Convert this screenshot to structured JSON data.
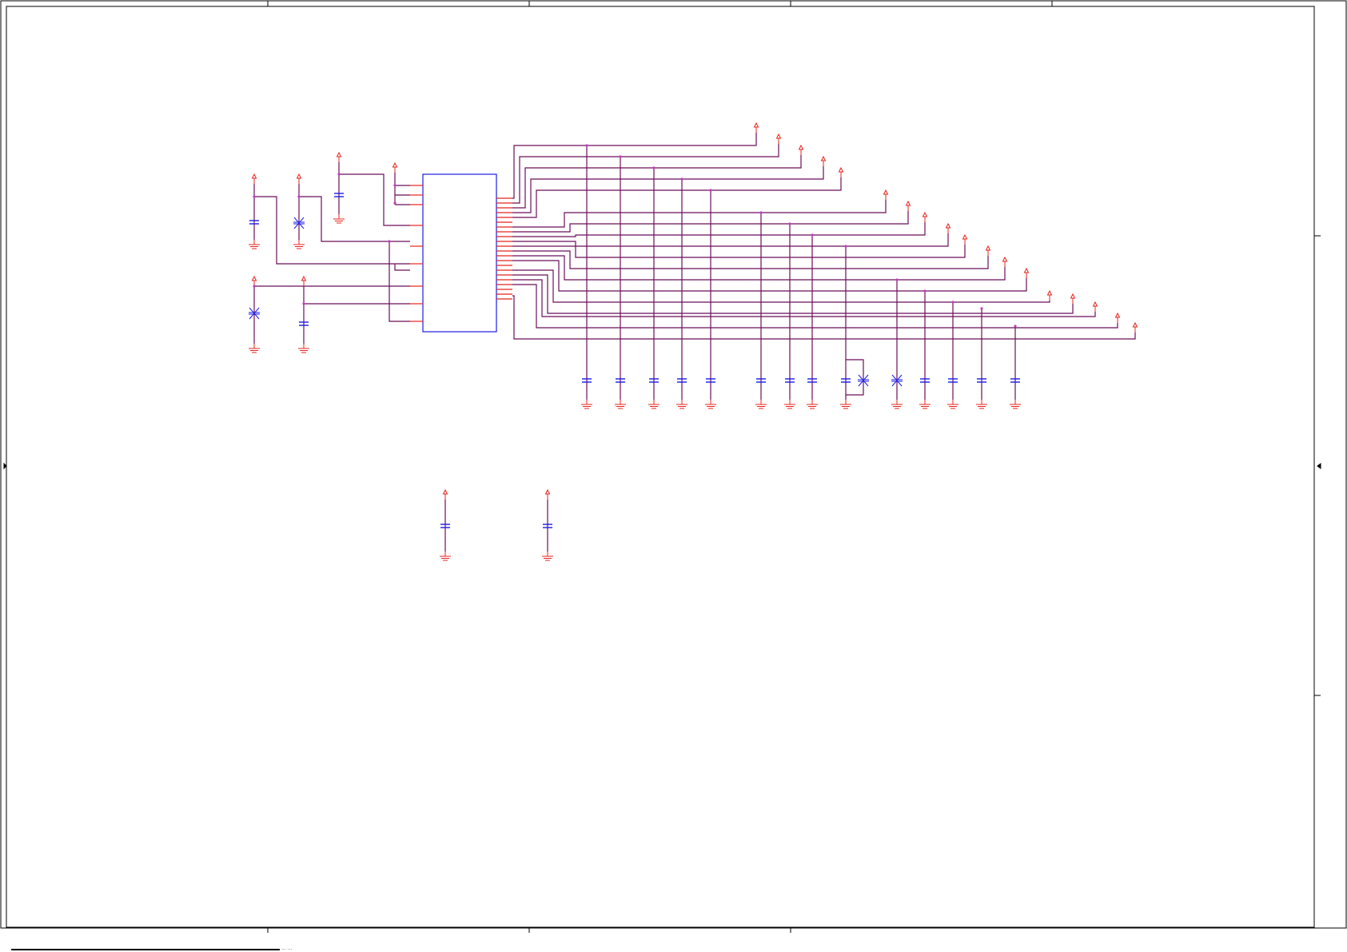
{
  "title_block": {
    "fragment": "... ..."
  },
  "colors": {
    "background": "#ffffff",
    "border": "#000000",
    "wire": "#6b0f5a",
    "pin": "#e8231d",
    "power_symbol": "#e8231d",
    "ground_symbol": "#e8231d",
    "component": "#1a1ae6",
    "junction": "#c03cc0"
  },
  "symbols": {
    "power": "power-port-arrow",
    "ground": "ground-symbol",
    "capacitor": "capacitor-symbol",
    "no_connect": "no-connect-cross",
    "ic": "ic-package-rectangle"
  }
}
